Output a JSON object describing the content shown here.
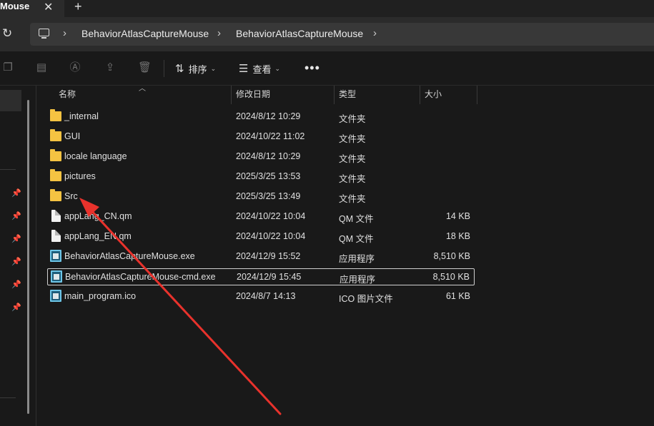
{
  "window": {
    "tab_title": "Mouse",
    "tab_close": "✕",
    "new_tab": "+"
  },
  "address": {
    "refresh_icon": "↻",
    "chevron": "›",
    "breadcrumbs": [
      "BehaviorAtlasCaptureMouse",
      "BehaviorAtlasCaptureMouse"
    ]
  },
  "toolbar": {
    "sort_label": "排序",
    "view_label": "查看",
    "more_label": "•••",
    "disabled_icons": [
      "copy-icon",
      "paste-icon",
      "rename-icon",
      "share-icon",
      "delete-icon"
    ]
  },
  "columns": {
    "name": "名称",
    "modified": "修改日期",
    "type": "类型",
    "size": "大小"
  },
  "files": [
    {
      "name": "_internal",
      "modified": "2024/8/12 10:29",
      "type": "文件夹",
      "size": "",
      "icon": "folder-icon"
    },
    {
      "name": "GUI",
      "modified": "2024/10/22 11:02",
      "type": "文件夹",
      "size": "",
      "icon": "folder-icon"
    },
    {
      "name": "locale language",
      "modified": "2024/8/12 10:29",
      "type": "文件夹",
      "size": "",
      "icon": "folder-icon"
    },
    {
      "name": "pictures",
      "modified": "2025/3/25 13:53",
      "type": "文件夹",
      "size": "",
      "icon": "folder-icon"
    },
    {
      "name": "Src",
      "modified": "2025/3/25 13:49",
      "type": "文件夹",
      "size": "",
      "icon": "folder-icon"
    },
    {
      "name": "appLang_CN.qm",
      "modified": "2024/10/22 10:04",
      "type": "QM 文件",
      "size": "14 KB",
      "icon": "document-icon"
    },
    {
      "name": "appLang_EN.qm",
      "modified": "2024/10/22 10:04",
      "type": "QM 文件",
      "size": "18 KB",
      "icon": "document-icon"
    },
    {
      "name": "BehaviorAtlasCaptureMouse.exe",
      "modified": "2024/12/9 15:52",
      "type": "应用程序",
      "size": "8,510 KB",
      "icon": "application-icon"
    },
    {
      "name": "BehaviorAtlasCaptureMouse-cmd.exe",
      "modified": "2024/12/9 15:45",
      "type": "应用程序",
      "size": "8,510 KB",
      "icon": "application-icon"
    },
    {
      "name": "main_program.ico",
      "modified": "2024/8/7 14:13",
      "type": "ICO 图片文件",
      "size": "61 KB",
      "icon": "image-icon"
    }
  ],
  "focused_row": 8,
  "annotation": {
    "arrow_color": "#e8322c",
    "points_to": "Src"
  },
  "colors": {
    "background": "#191919",
    "folder": "#f5c342"
  }
}
